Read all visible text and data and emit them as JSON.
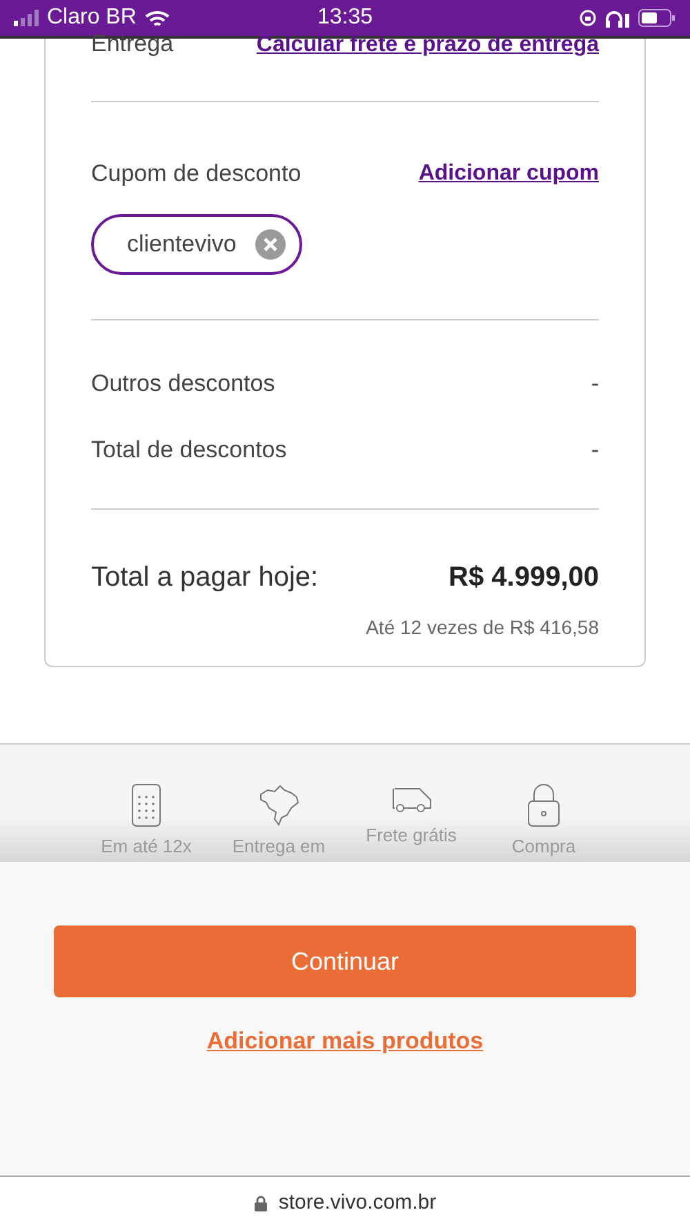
{
  "status_bar": {
    "carrier": "Claro BR",
    "time": "13:35"
  },
  "delivery": {
    "label": "Entrega",
    "link": "Calcular frete e prazo de entrega"
  },
  "coupon": {
    "label": "Cupom de desconto",
    "link": "Adicionar cupom",
    "code": "clientevivo"
  },
  "discounts": [
    {
      "label": "Outros descontos",
      "value": "-"
    },
    {
      "label": "Total de descontos",
      "value": "-"
    }
  ],
  "total": {
    "label": "Total a pagar hoje:",
    "value": "R$ 4.999,00",
    "installments": "Até 12 vezes de R$ 416,58"
  },
  "features": [
    {
      "kind": "calculator",
      "label": "Em até 12x"
    },
    {
      "kind": "map",
      "label": "Entrega em"
    },
    {
      "kind": "truck",
      "label": "Frete grátis"
    },
    {
      "kind": "lock",
      "label": "Compra"
    }
  ],
  "primary_button": "Continuar",
  "secondary_link": "Adicionar mais produtos",
  "url": "store.vivo.com.br"
}
